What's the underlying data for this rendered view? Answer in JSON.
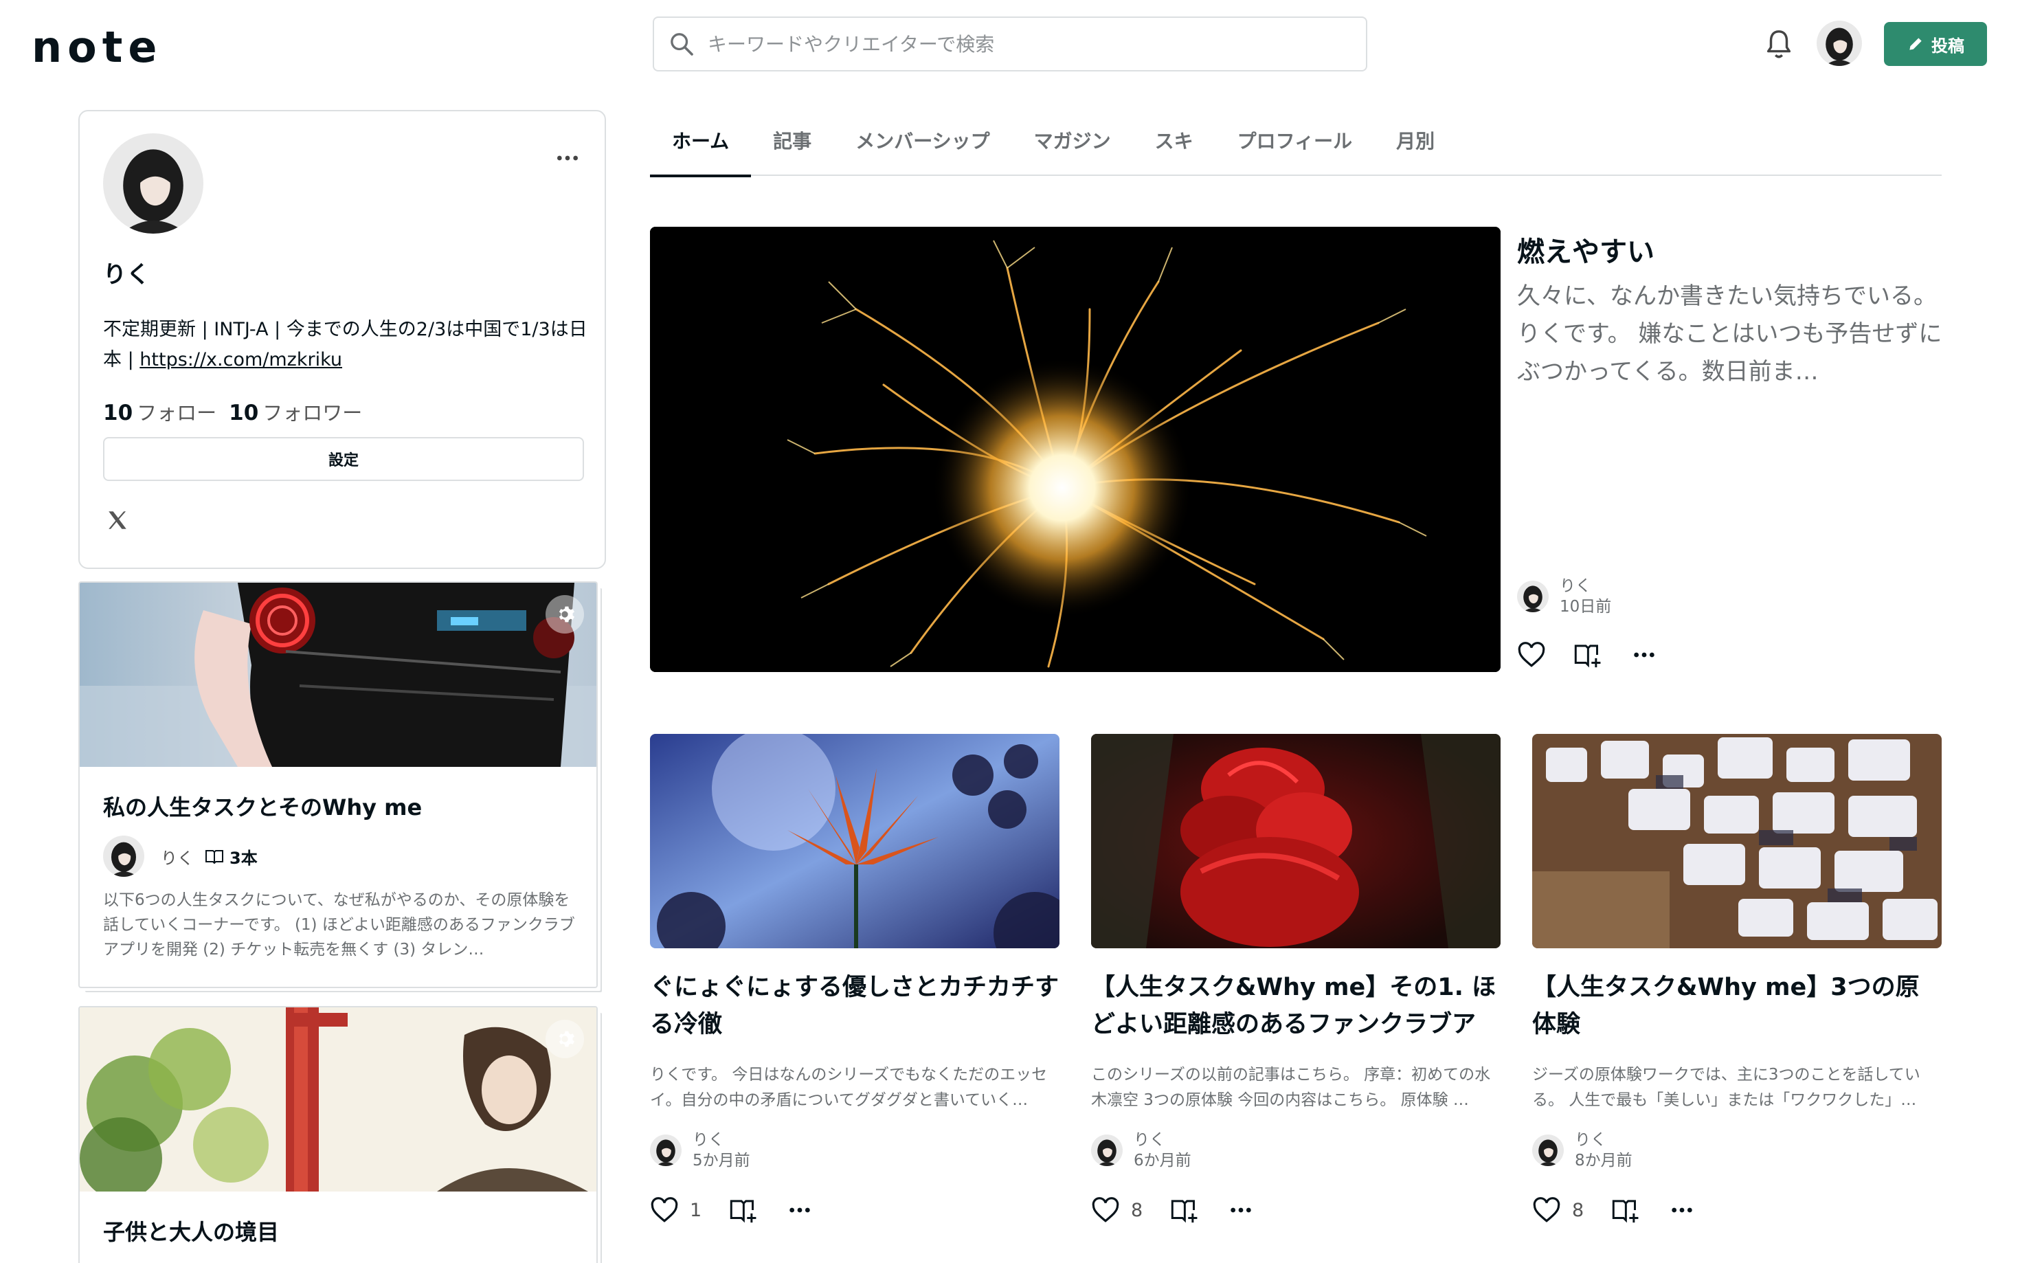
{
  "header": {
    "logo": "note",
    "search_placeholder": "キーワードやクリエイターで検索",
    "post_label": "投稿"
  },
  "profile": {
    "name": "りく",
    "bio": "不定期更新 | INTJ-A | 今までの人生の2/3は中国で1/3は日本 |",
    "link": "https://x.com/mzkriku",
    "follow_count": "10",
    "follow_label": "フォロー",
    "follower_count": "10",
    "follower_label": "フォロワー",
    "settings_label": "設定"
  },
  "magazines": [
    {
      "title": "私の人生タスクとそのWhy me",
      "author": "りく",
      "count": "3本",
      "description": "以下6つの人生タスクについて、なぜ私がやるのか、その原体験を話していくコーナーです。 (1) ほどよい距離感のあるファンクラブアプリを開発 (2) チケット転売を無くす (3) タレン…"
    },
    {
      "title": "子供と大人の境目"
    }
  ],
  "tabs": [
    "ホーム",
    "記事",
    "メンバーシップ",
    "マガジン",
    "スキ",
    "プロフィール",
    "月別"
  ],
  "featured": {
    "title": "燃えやすい",
    "excerpt": "久々に、なんか書きたい気持ちでいる。 りくです。 嫌なことはいつも予告せずにぶつかってくる。数日前ま…",
    "author": "りく",
    "time": "10日前"
  },
  "articles": [
    {
      "title": "ぐにょぐにょする優しさとカチカチする冷徹",
      "excerpt": "りくです。 今日はなんのシリーズでもなくただのエッセイ。自分の中の矛盾についてグダグダと書いていく…",
      "author": "りく",
      "time": "5か月前",
      "likes": "1"
    },
    {
      "title": "【人生タスク&Why me】その1. ほどよい距離感のあるファンクラブアプ…",
      "excerpt": "このシリーズの以前の記事はこちら。 序章：初めての水木凛空 3つの原体験 今回の内容はこちら。 原体験 …",
      "author": "りく",
      "time": "6か月前",
      "likes": "8"
    },
    {
      "title": "【人生タスク&Why me】3つの原体験",
      "excerpt": "ジーズの原体験ワークでは、主に3つのことを話している。 人生で最も「美しい」または「ワクワクした」…",
      "author": "りく",
      "time": "8か月前",
      "likes": "8"
    }
  ],
  "colors": {
    "accent": "#2e8b6e",
    "border": "#dcdfe1",
    "text": "#08131a",
    "muted": "#6b6f72"
  }
}
